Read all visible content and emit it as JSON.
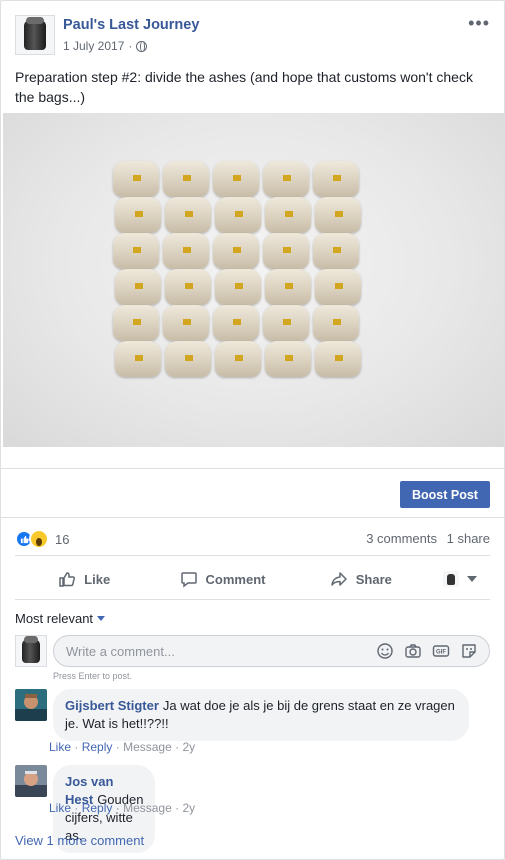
{
  "post": {
    "page_name": "Paul's Last Journey",
    "date": "1 July 2017",
    "date_separator": "·",
    "text": "Preparation step #2: divide the ashes (and hope that customs won't check the bags...)",
    "more_label": "•••"
  },
  "photo": {
    "bags_rows": 6,
    "bags_cols": 5
  },
  "boost": {
    "label": "Boost Post",
    "color": "#4267b2"
  },
  "stats": {
    "reaction_count": "16",
    "comments": "3 comments",
    "shares": "1 share"
  },
  "actions": {
    "like": "Like",
    "comment": "Comment",
    "share": "Share"
  },
  "comments_section": {
    "sort_label": "Most relevant",
    "input_placeholder": "Write a comment...",
    "press_enter": "Press Enter to post.",
    "items": [
      {
        "author": "Gijsbert Stigter",
        "text": "Ja wat doe je als je bij de grens staat en ze vragen je. Wat is het!!??!!",
        "like": "Like",
        "reply": "Reply",
        "message": "Message",
        "sep": "·",
        "time": "2y"
      },
      {
        "author": "Jos van Hest",
        "text": "Gouden cijfers, witte as.",
        "like": "Like",
        "reply": "Reply",
        "message": "Message",
        "sep": "·",
        "time": "2y"
      }
    ],
    "view_more": "View 1 more comment"
  }
}
